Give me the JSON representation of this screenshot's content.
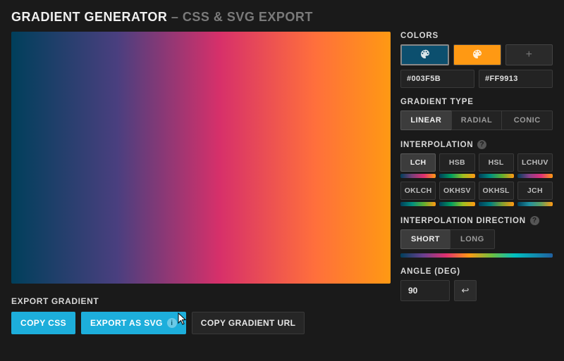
{
  "header": {
    "title": "GRADIENT GENERATOR",
    "separator": " – ",
    "subtitle": "CSS & SVG EXPORT"
  },
  "colors": {
    "label": "COLORS",
    "stops": [
      {
        "hex": "#003F5B",
        "selected": true
      },
      {
        "hex": "#FF9913",
        "selected": false
      }
    ],
    "add_label": "+"
  },
  "gradient_type": {
    "label": "GRADIENT TYPE",
    "options": [
      "LINEAR",
      "RADIAL",
      "CONIC"
    ],
    "selected": "LINEAR"
  },
  "interpolation": {
    "label": "INTERPOLATION",
    "options": [
      "LCH",
      "HSB",
      "HSL",
      "LCHUV",
      "OKLCH",
      "OKHSV",
      "OKHSL",
      "JCH"
    ],
    "selected": "LCH",
    "previews": [
      "linear-gradient(90deg,#003F5B,#7a3f7a,#e03070,#ff9913)",
      "linear-gradient(90deg,#003F5B,#00a060,#a0c020,#ff9913)",
      "linear-gradient(90deg,#003F5B,#009080,#60b030,#ff9913)",
      "linear-gradient(90deg,#003F5B,#8a3f8a,#e0307a,#ff9913)",
      "linear-gradient(90deg,#003F5B,#009080,#60b030,#ff9913)",
      "linear-gradient(90deg,#003F5B,#00a060,#a0c020,#ff9913)",
      "linear-gradient(90deg,#003F5B,#008080,#80a030,#ff9913)",
      "linear-gradient(90deg,#003F5B,#2090a0,#60a060,#ff9913)"
    ]
  },
  "interpolation_direction": {
    "label": "INTERPOLATION DIRECTION",
    "options": [
      "SHORT",
      "LONG"
    ],
    "selected": "SHORT"
  },
  "angle": {
    "label": "ANGLE (DEG)",
    "value": "90",
    "swap_icon": "↩"
  },
  "export": {
    "label": "EXPORT GRADIENT",
    "copy_css": "COPY CSS",
    "export_svg": "EXPORT AS SVG",
    "copy_url": "COPY GRADIENT URL"
  },
  "icons": {
    "palette": "🎨",
    "info": "i",
    "help": "?"
  }
}
